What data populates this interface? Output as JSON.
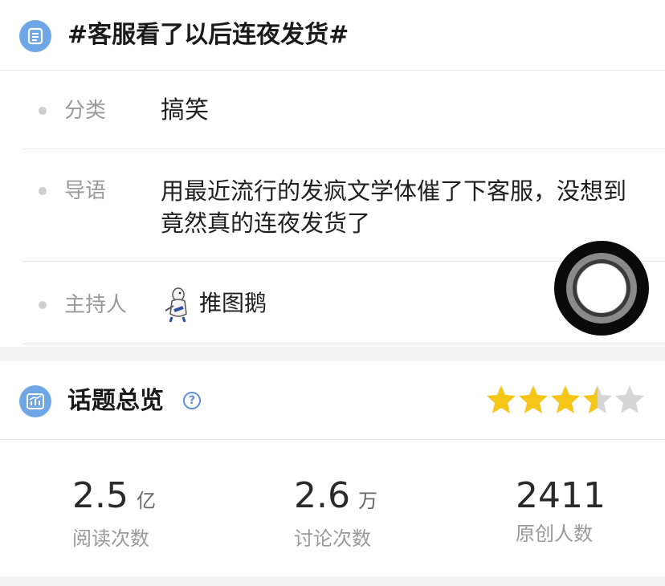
{
  "topic": {
    "title": "#客服看了以后连夜发货#",
    "icon": "list-document-icon",
    "accent": "#6fa6e6"
  },
  "info": {
    "category": {
      "label": "分类",
      "value": "搞笑"
    },
    "intro": {
      "label": "导语",
      "value": "用最近流行的发疯文学体催了下客服，没想到竟然真的连夜发货了"
    },
    "host": {
      "label": "主持人",
      "value": "推图鹅",
      "avatar_icon": "penguin-avatar-icon"
    }
  },
  "overview": {
    "title": "话题总览",
    "icon": "bar-chart-icon",
    "help_icon": "question-circle-icon",
    "rating": {
      "value": 3.5,
      "max": 5,
      "star_color": "#f5c518",
      "empty_color": "#d6d6d6"
    },
    "stats": [
      {
        "number": "2.5",
        "unit": "亿",
        "caption": "阅读次数"
      },
      {
        "number": "2.6",
        "unit": "万",
        "caption": "讨论次数"
      },
      {
        "number": "2411",
        "unit": "",
        "caption": "原创人数"
      }
    ]
  }
}
